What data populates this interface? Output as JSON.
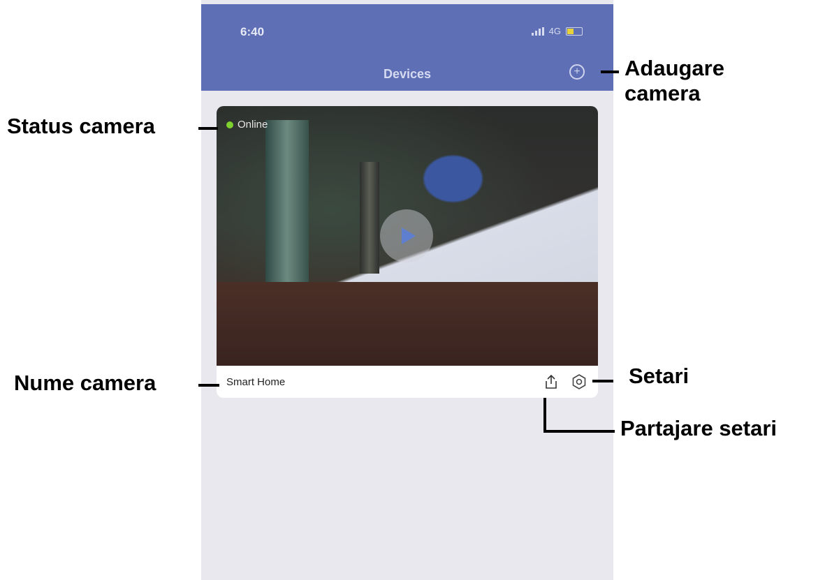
{
  "status_bar": {
    "time": "6:40",
    "network": "4G"
  },
  "header": {
    "title": "Devices"
  },
  "camera_card": {
    "status": "Online",
    "name": "Smart Home",
    "status_color": "#7fd12f"
  },
  "annotations": {
    "add_camera_line1": "Adaugare",
    "add_camera_line2": "camera",
    "status_camera": "Status camera",
    "camera_name": "Nume camera",
    "settings": "Setari",
    "share_settings": "Partajare setari"
  },
  "colors": {
    "header": "#5e6fb5",
    "background": "#e9e8ee",
    "card": "#ffffff"
  }
}
